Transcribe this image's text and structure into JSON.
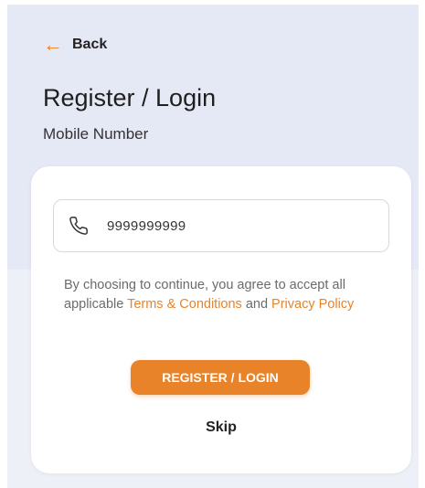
{
  "header": {
    "back_label": "Back",
    "title": "Register / Login",
    "subtitle": "Mobile Number"
  },
  "form": {
    "phone_icon": "phone-icon",
    "phone_value": "9999999999",
    "consent_prefix": "By choosing to continue, you agree to accept all applicable ",
    "terms_link": "Terms & Conditions",
    "consent_middle": " and ",
    "privacy_link": "Privacy Policy",
    "submit_label": "REGISTER / LOGIN",
    "skip_label": "Skip"
  },
  "colors": {
    "accent": "#e8832a",
    "header_background": "#e5e8f5",
    "card_background": "#ffffff"
  }
}
